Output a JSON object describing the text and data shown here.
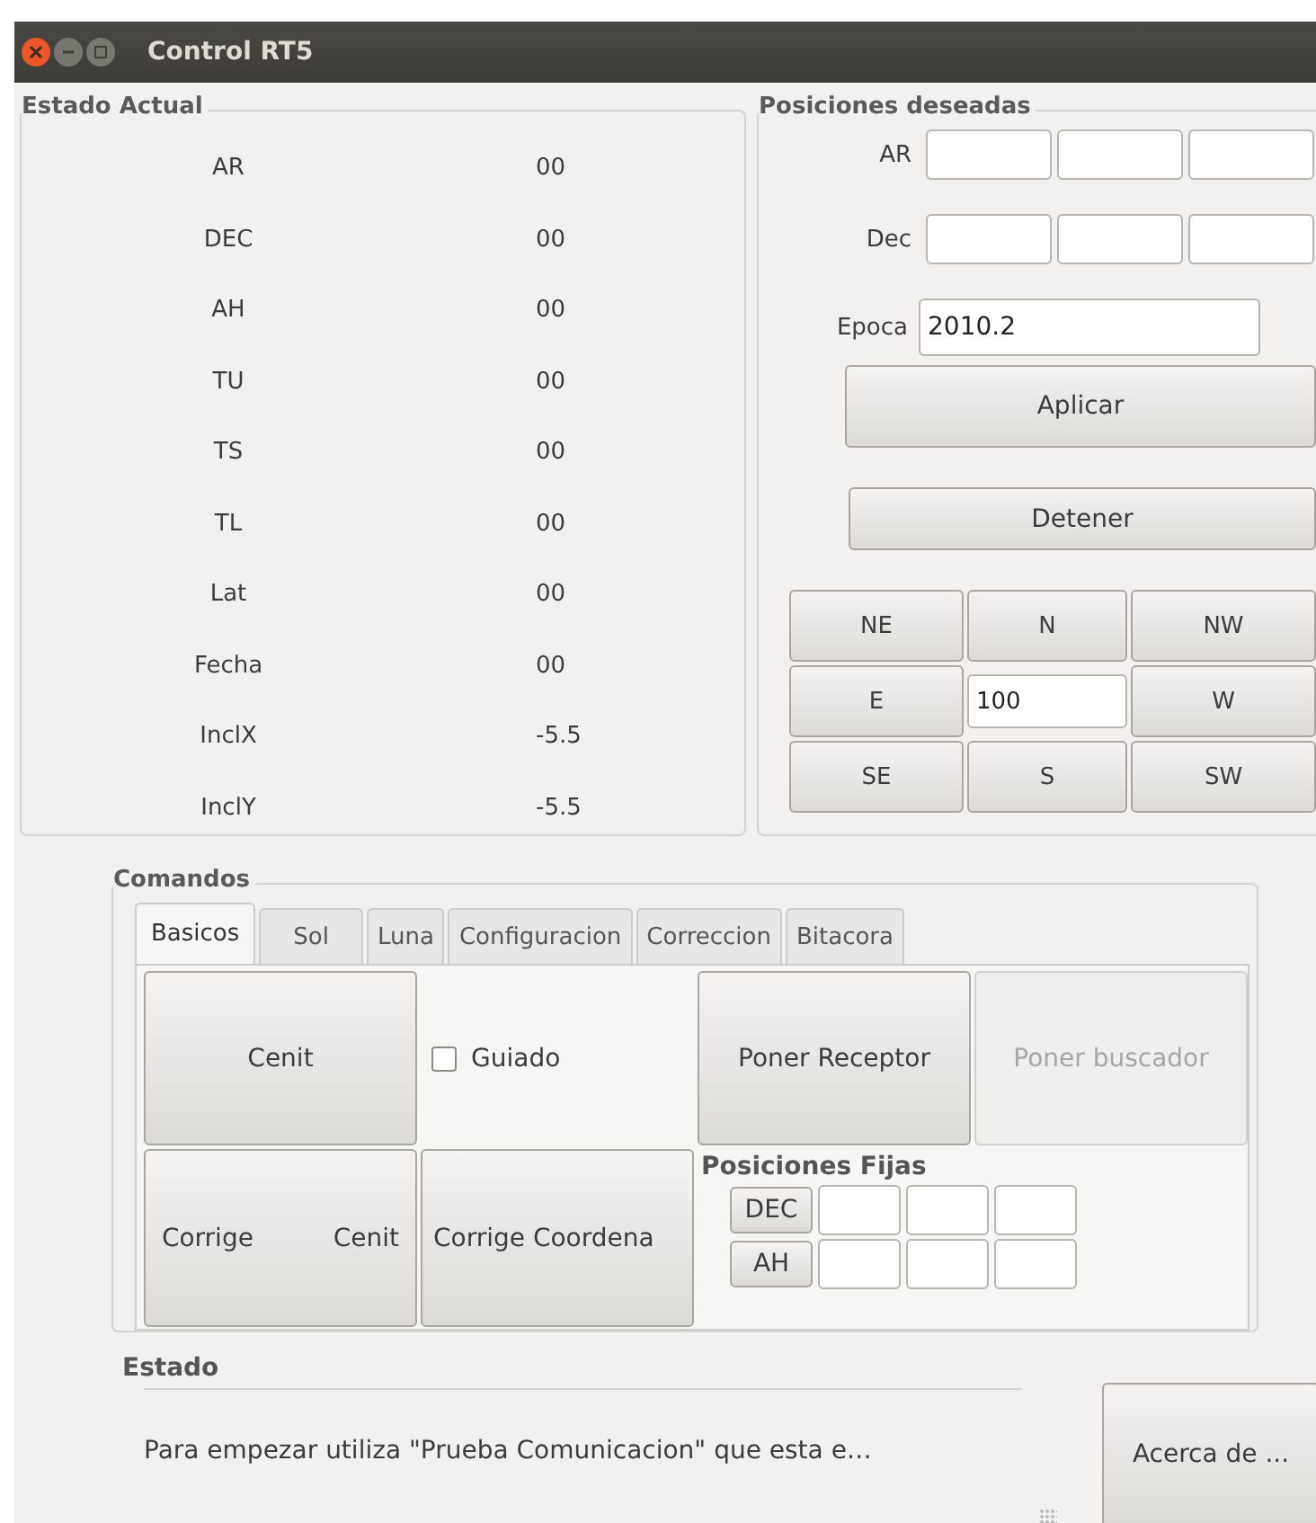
{
  "window": {
    "title": "Control RT5"
  },
  "estado_actual": {
    "title": "Estado Actual",
    "rows": [
      {
        "label": "AR",
        "value": "00"
      },
      {
        "label": "DEC",
        "value": "00"
      },
      {
        "label": "AH",
        "value": "00"
      },
      {
        "label": "TU",
        "value": "00"
      },
      {
        "label": "TS",
        "value": "00"
      },
      {
        "label": "TL",
        "value": "00"
      },
      {
        "label": "Lat",
        "value": "00"
      },
      {
        "label": "Fecha",
        "value": "00"
      },
      {
        "label": "InclX",
        "value": "-5.5"
      },
      {
        "label": "InclY",
        "value": "-5.5"
      }
    ]
  },
  "posiciones_deseadas": {
    "title": "Posiciones deseadas",
    "coords": [
      {
        "label": "AR"
      },
      {
        "label": "Dec"
      }
    ],
    "epoca": {
      "label": "Epoca",
      "value": "2010.2"
    },
    "buttons": [
      "Aplicar",
      "Detener"
    ],
    "pad": [
      {
        "kind": "button",
        "label": "NE"
      },
      {
        "kind": "button",
        "label": "N"
      },
      {
        "kind": "button",
        "label": "NW"
      },
      {
        "kind": "button",
        "label": "E"
      },
      {
        "kind": "field",
        "label": "100"
      },
      {
        "kind": "button",
        "label": "W"
      },
      {
        "kind": "button",
        "label": "SE"
      },
      {
        "kind": "button",
        "label": "S"
      },
      {
        "kind": "button",
        "label": "SW"
      }
    ]
  },
  "comandos": {
    "title": "Comandos",
    "tabs": [
      {
        "label": "Basicos",
        "selected": true
      },
      {
        "label": "Sol",
        "selected": false
      },
      {
        "label": "Luna",
        "selected": false
      },
      {
        "label": "Configuracion",
        "selected": false
      },
      {
        "label": "Correccion",
        "selected": false
      },
      {
        "label": "Bitacora",
        "selected": false
      }
    ],
    "buttons": [
      {
        "label": "Cenit",
        "disabled": false
      },
      {
        "label": "Poner Receptor",
        "disabled": false
      },
      {
        "label": "Poner buscador",
        "disabled": true
      },
      {
        "label": "Corrige Cenit",
        "disabled": false
      },
      {
        "label": "Corrige Coordena",
        "disabled": false
      }
    ],
    "guiado": {
      "label": "Guiado",
      "checked": false
    },
    "fijas": {
      "title": "Posiciones Fijas",
      "rows": [
        {
          "label": "DEC"
        },
        {
          "label": "AH"
        }
      ]
    }
  },
  "estado": {
    "title": "Estado",
    "message": "Para empezar utiliza \"Prueba Comunicacion\" que esta e…",
    "button": "Acerca de ..."
  }
}
